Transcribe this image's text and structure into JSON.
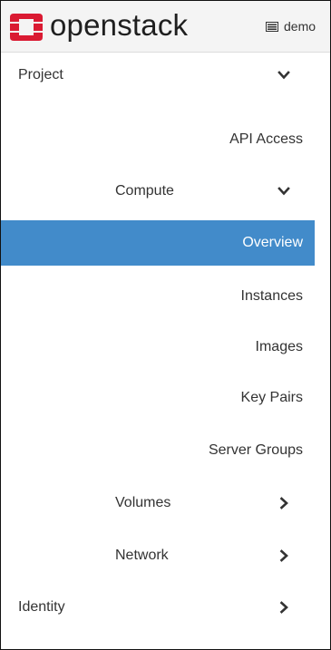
{
  "header": {
    "brand": "openstack",
    "brand_color": "#da1a32",
    "project_selector": "demo",
    "project_icon": "server-icon"
  },
  "nav": {
    "active_color": "#428bca",
    "items": [
      {
        "label": "Project",
        "level": 1,
        "chevron": "chevron-down-icon"
      },
      {
        "label": "API Access",
        "level": 3
      },
      {
        "label": "Compute",
        "level": 2,
        "chevron": "chevron-down-icon"
      },
      {
        "label": "Overview",
        "level": 3,
        "active": true
      },
      {
        "label": "Instances",
        "level": 3
      },
      {
        "label": "Images",
        "level": 3
      },
      {
        "label": "Key Pairs",
        "level": 3
      },
      {
        "label": "Server Groups",
        "level": 3
      },
      {
        "label": "Volumes",
        "level": 2,
        "chevron": "chevron-right-icon"
      },
      {
        "label": "Network",
        "level": 2,
        "chevron": "chevron-right-icon"
      },
      {
        "label": "Identity",
        "level": 1,
        "chevron": "chevron-right-icon"
      }
    ]
  }
}
